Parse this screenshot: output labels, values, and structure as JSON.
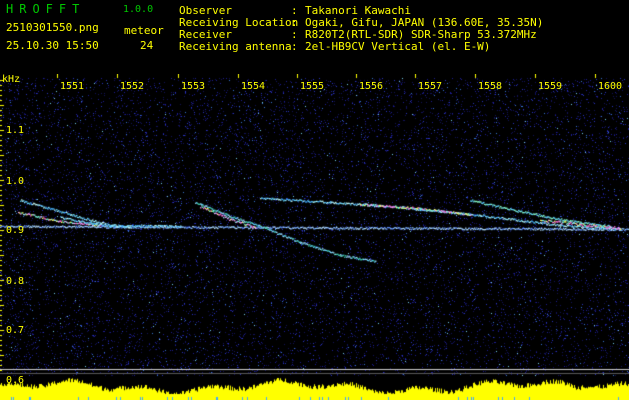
{
  "app": {
    "title": "HROFFT",
    "version": "1.0.0"
  },
  "file": {
    "name": "2510301550.png",
    "timestamp": "25.10.30 15:50"
  },
  "meteor": {
    "label": "meteor",
    "count": "24"
  },
  "info": [
    {
      "key": "Observer",
      "value": "Takanori Kawachi"
    },
    {
      "key": "Receiving Location",
      "value": "Ogaki, Gifu, JAPAN (136.60E, 35.35N)"
    },
    {
      "key": "Receiver",
      "value": "R820T2(RTL-SDR) SDR-Sharp 53.372MHz"
    },
    {
      "key": "Receiving antenna",
      "value": "2el-HB9CV Vertical (el. E-W)"
    }
  ],
  "axes": {
    "y_unit": "kHz",
    "y_ticks": [
      "1.1",
      "1.0",
      "0.9",
      "0.8",
      "0.7",
      "0.6"
    ],
    "x_ticks": [
      "1551",
      "1552",
      "1553",
      "1554",
      "1555",
      "1556",
      "1557",
      "1558",
      "1559",
      "1600"
    ]
  },
  "colors": {
    "background": "#000000",
    "label": "#ffff00",
    "title": "#00c800",
    "noise": "#1a1a7a",
    "carrier": "#9fd8ff",
    "power": "#ffff00"
  }
}
